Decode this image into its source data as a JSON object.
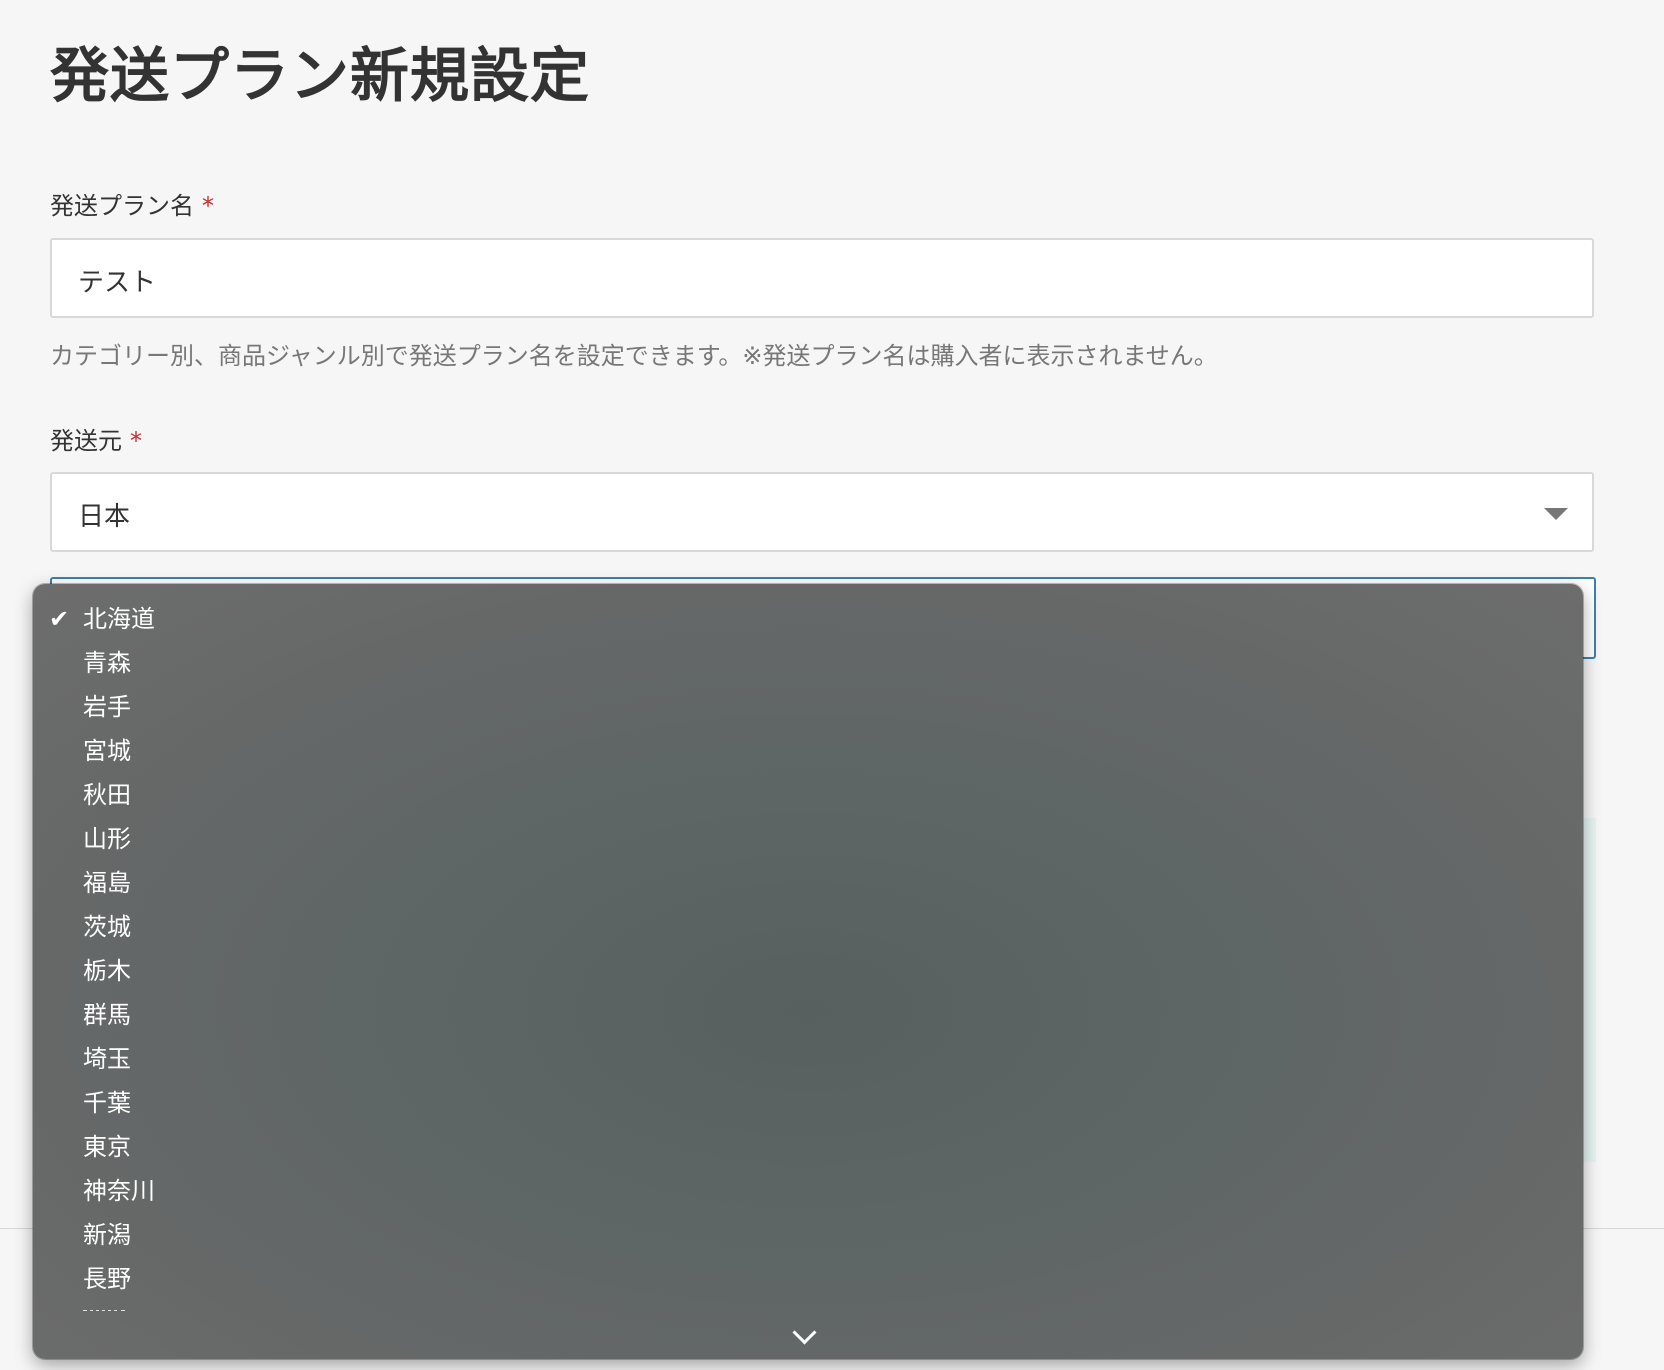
{
  "header": {
    "title": "発送プラン新規設定"
  },
  "plan_name": {
    "label": "発送プラン名",
    "required_mark": "*",
    "value": "テスト",
    "help": "カテゴリー別、商品ジャンル別で発送プラン名を設定できます。※発送プラン名は購入者に表示されません。"
  },
  "origin": {
    "label": "発送元",
    "required_mark": "*",
    "country_value": "日本",
    "country_icon": "chevron-down-icon"
  },
  "prefecture_dropdown": {
    "selected_index": 0,
    "check_icon": "check-icon",
    "scroll_icon": "chevron-down-icon",
    "options": [
      "北海道",
      "青森",
      "岩手",
      "宮城",
      "秋田",
      "山形",
      "福島",
      "茨城",
      "栃木",
      "群馬",
      "埼玉",
      "千葉",
      "東京",
      "神奈川",
      "新潟",
      "長野"
    ]
  },
  "colors": {
    "background": "#f6f6f6",
    "required": "#cc2a2a",
    "focus_border": "#3b7fb3",
    "dropdown_bg": "#5d6565",
    "teal_panel": "#e7f4f1"
  }
}
